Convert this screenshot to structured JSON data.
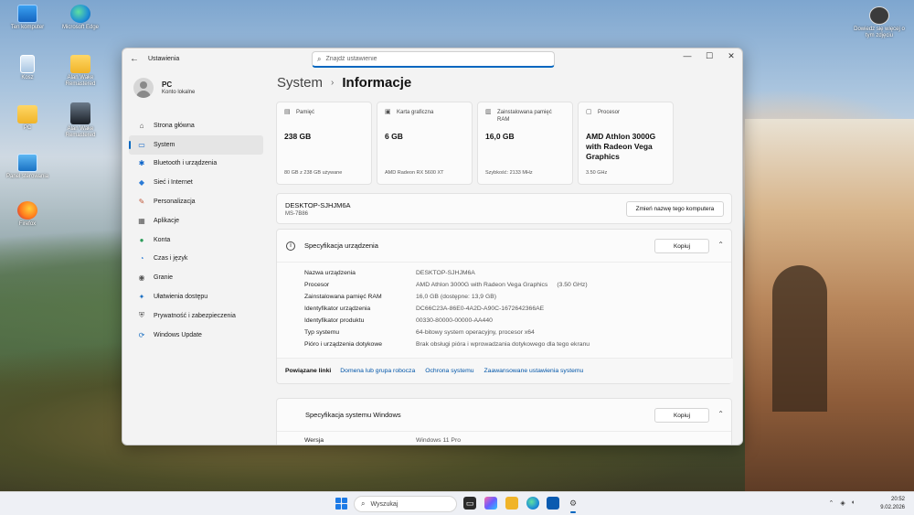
{
  "desktop": {
    "icons": [
      {
        "label": "Ten komputer"
      },
      {
        "label": "Microsoft Edge"
      },
      {
        "label": "Kosz"
      },
      {
        "label": "Alan Wake Remastered"
      },
      {
        "label": "PC"
      },
      {
        "label": "Alan Wake Remastered"
      },
      {
        "label": "Panel sterowania"
      },
      {
        "label": "Firefox"
      },
      {
        "label": "Dowiedz się więcej o tym zdjęciu"
      }
    ]
  },
  "window": {
    "app_title": "Ustawienia",
    "search_placeholder": "Znajdź ustawienie",
    "controls": {
      "minimize": "—",
      "maximize": "☐",
      "close": "✕"
    }
  },
  "user": {
    "name": "PC",
    "account": "Konto lokalne"
  },
  "nav": [
    {
      "label": "Strona główna",
      "icon": "home-icon",
      "glyph": "⌂",
      "color": "#444"
    },
    {
      "label": "System",
      "icon": "monitor-icon",
      "glyph": "▭",
      "color": "#0a63c9",
      "active": true
    },
    {
      "label": "Bluetooth i urządzenia",
      "icon": "bluetooth-icon",
      "glyph": "✱",
      "color": "#0a63c9"
    },
    {
      "label": "Sieć i Internet",
      "icon": "network-icon",
      "glyph": "◆",
      "color": "#2b7bd6"
    },
    {
      "label": "Personalizacja",
      "icon": "brush-icon",
      "glyph": "✎",
      "color": "#c0583a"
    },
    {
      "label": "Aplikacje",
      "icon": "apps-icon",
      "glyph": "▦",
      "color": "#555"
    },
    {
      "label": "Konta",
      "icon": "accounts-icon",
      "glyph": "●",
      "color": "#2c9c5a"
    },
    {
      "label": "Czas i język",
      "icon": "clock-globe-icon",
      "glyph": "◔",
      "color": "#2b7bd6"
    },
    {
      "label": "Granie",
      "icon": "gaming-icon",
      "glyph": "◉",
      "color": "#555"
    },
    {
      "label": "Ułatwienia dostępu",
      "icon": "accessibility-icon",
      "glyph": "✦",
      "color": "#1b6fc2"
    },
    {
      "label": "Prywatność i zabezpieczenia",
      "icon": "shield-icon",
      "glyph": "⛨",
      "color": "#555"
    },
    {
      "label": "Windows Update",
      "icon": "update-icon",
      "glyph": "⟳",
      "color": "#1b6fc2"
    }
  ],
  "breadcrumb": {
    "parent": "System",
    "separator": "›",
    "current": "Informacje"
  },
  "cards": [
    {
      "title": "Pamięć",
      "value": "238 GB",
      "sub": "80 GB z 238 GB używane",
      "icon": "storage-icon",
      "glyph": "▤"
    },
    {
      "title": "Karta graficzna",
      "value": "6 GB",
      "sub": "AMD Radeon RX 5600 XT",
      "icon": "gpu-icon",
      "glyph": "▣"
    },
    {
      "title": "Zainstalowana pamięć RAM",
      "value": "16,0 GB",
      "sub": "Szybkość: 2133 MHz",
      "icon": "ram-icon",
      "glyph": "▥"
    },
    {
      "title": "Procesor",
      "value": "AMD Athlon 3000G with Radeon Vega Graphics",
      "sub": "3.50 GHz",
      "icon": "cpu-icon",
      "glyph": "▢"
    }
  ],
  "device": {
    "name": "DESKTOP-SJHJM6A",
    "model": "MS-7B86",
    "rename_label": "Zmień nazwę tego komputera"
  },
  "device_spec": {
    "title": "Specyfikacja urządzenia",
    "copy_label": "Kopiuj",
    "rows": [
      {
        "key": "Nazwa urządzenia",
        "value": "DESKTOP-SJHJM6A",
        "extra": ""
      },
      {
        "key": "Procesor",
        "value": "AMD Athlon 3000G with Radeon Vega Graphics",
        "extra": "(3.50 GHz)"
      },
      {
        "key": "Zainstalowana pamięć RAM",
        "value": "16,0 GB (dostępne: 13,9 GB)",
        "extra": ""
      },
      {
        "key": "Identyfikator urządzenia",
        "value": "DC66C23A-86E0-4A2D-A90C-1672642366AE",
        "extra": ""
      },
      {
        "key": "Identyfikator produktu",
        "value": "00330-80000-00000-AA440",
        "extra": ""
      },
      {
        "key": "Typ systemu",
        "value": "64-bitowy system operacyjny, procesor x64",
        "extra": ""
      },
      {
        "key": "Pióro i urządzenia dotykowe",
        "value": "Brak obsługi pióra i wprowadzania dotykowego dla tego ekranu",
        "extra": ""
      }
    ],
    "related_label": "Powiązane linki",
    "related_links": [
      "Domena lub grupa robocza",
      "Ochrona systemu",
      "Zaawansowane ustawienia systemu"
    ]
  },
  "windows_spec": {
    "title": "Specyfikacja systemu Windows",
    "copy_label": "Kopiuj",
    "rows": [
      {
        "key": "Wersja",
        "value": "Windows 11 Pro",
        "extra": ""
      }
    ]
  },
  "taskbar": {
    "search_label": "Wyszukaj",
    "time": "20:52",
    "date": "9.02.2026"
  },
  "colors": {
    "accent": "#0067c0",
    "link": "#0055a8"
  }
}
